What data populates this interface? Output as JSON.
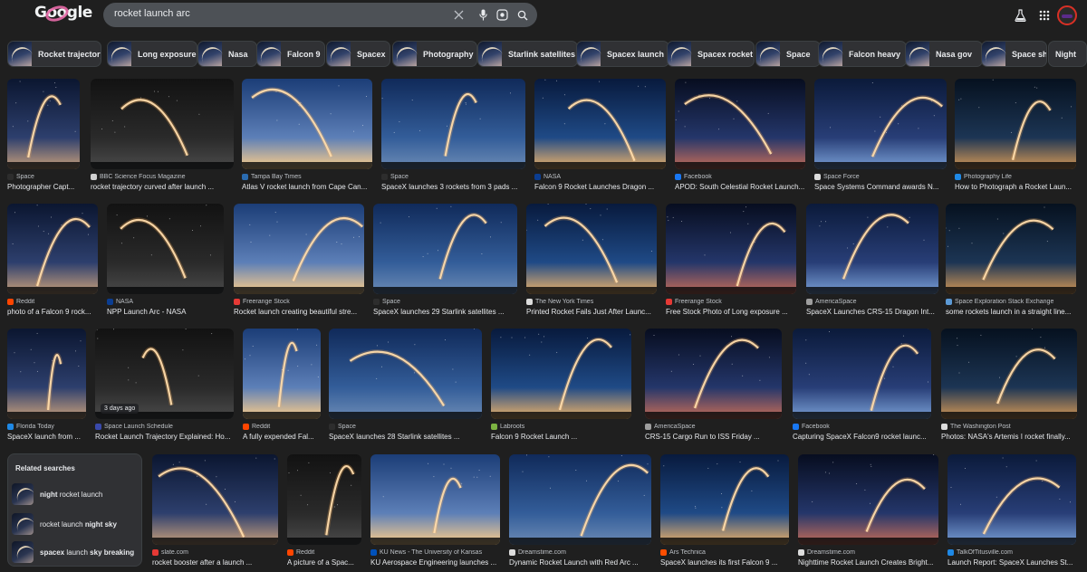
{
  "header": {
    "logo_text": "Google",
    "search_query": "rocket launch arc",
    "icons": [
      "clear-icon",
      "microphone-icon",
      "lens-icon",
      "search-icon",
      "labs-flask-icon",
      "apps-grid-icon"
    ]
  },
  "chips": [
    "Rocket trajectory",
    "Long exposure",
    "Nasa",
    "Falcon 9",
    "Spacex",
    "Photography",
    "Starlink satellites",
    "Spacex launch",
    "Spacex rocket",
    "Space",
    "Falcon heavy",
    "Nasa gov",
    "Space shuttle",
    "Night"
  ],
  "results": [
    [
      {
        "source": "Space",
        "caption": "Photographer Capt...",
        "fav": "#2d2d2d"
      },
      {
        "source": "BBC Science Focus Magazine",
        "caption": "rocket trajectory curved after launch ...",
        "fav": "#cfcfcf"
      },
      {
        "source": "Tampa Bay Times",
        "caption": "Atlas V rocket launch from Cape Can...",
        "fav": "#2a6bb0"
      },
      {
        "source": "Space",
        "caption": "SpaceX launches 3 rockets from 3 pads ...",
        "fav": "#2d2d2d"
      },
      {
        "source": "NASA",
        "caption": "Falcon 9 Rocket Launches Dragon ...",
        "fav": "#0b3d91"
      },
      {
        "source": "Facebook",
        "caption": "APOD: South Celestial Rocket Launch...",
        "fav": "#1877f2"
      },
      {
        "source": "Space Force",
        "caption": "Space Systems Command awards N...",
        "fav": "#dcdcdc"
      },
      {
        "source": "Photography Life",
        "caption": "How to Photograph a Rocket Laun...",
        "fav": "#1e88e5"
      }
    ],
    [
      {
        "source": "Reddit",
        "caption": "photo of a Falcon 9 rock...",
        "fav": "#ff4500"
      },
      {
        "source": "NASA",
        "caption": "NPP Launch Arc - NASA",
        "fav": "#0b3d91"
      },
      {
        "source": "Freerange Stock",
        "caption": "Rocket launch creating beautiful stre...",
        "fav": "#e53935"
      },
      {
        "source": "Space",
        "caption": "SpaceX launches 29 Starlink satellites ...",
        "fav": "#2d2d2d"
      },
      {
        "source": "The New York Times",
        "caption": "Printed Rocket Fails Just After Launc...",
        "fav": "#dcdcdc"
      },
      {
        "source": "Freerange Stock",
        "caption": "Free Stock Photo of Long exposure ...",
        "fav": "#e53935"
      },
      {
        "source": "AmericaSpace",
        "caption": "SpaceX Launches CRS-15 Dragon Int...",
        "fav": "#9e9e9e"
      },
      {
        "source": "Space Exploration Stack Exchange",
        "caption": "some rockets launch in a straight line...",
        "fav": "#5c9ad6"
      }
    ],
    [
      {
        "source": "Florida Today",
        "caption": "SpaceX launch from ...",
        "fav": "#1e88e5"
      },
      {
        "source": "Space Launch Schedule",
        "caption": "Rocket Launch Trajectory Explained: Ho...",
        "fav": "#3949ab",
        "badge_text": "3 days ago"
      },
      {
        "source": "Reddit",
        "caption": "A fully expended Fal...",
        "fav": "#ff4500"
      },
      {
        "source": "Space",
        "caption": "SpaceX launches 28 Starlink satellites ...",
        "fav": "#2d2d2d"
      },
      {
        "source": "Labroots",
        "caption": "Falcon 9 Rocket Launch ...",
        "fav": "#7cb342"
      },
      {
        "source": "AmericaSpace",
        "caption": "CRS-15 Cargo Run to ISS Friday ...",
        "fav": "#9e9e9e"
      },
      {
        "source": "Facebook",
        "caption": "Capturing SpaceX Falcon9 rocket launc...",
        "fav": "#1877f2"
      },
      {
        "source": "The Washington Post",
        "caption": "Photos: NASA's Artemis I rocket finally...",
        "fav": "#dcdcdc"
      }
    ],
    [
      {
        "source": "slate.com",
        "caption": "rocket booster after a launch ...",
        "fav": "#e53935"
      },
      {
        "source": "Reddit",
        "caption": "A picture of a Spac...",
        "fav": "#ff4500"
      },
      {
        "source": "KU News - The University of Kansas",
        "caption": "KU Aerospace Engineering launches ...",
        "fav": "#0051ba"
      },
      {
        "source": "Dreamstime.com",
        "caption": "Dynamic Rocket Launch with Red Arc ...",
        "fav": "#dcdcdc"
      },
      {
        "source": "Ars Technica",
        "caption": "SpaceX launches its first Falcon 9 ...",
        "fav": "#ff4e00"
      },
      {
        "source": "Dreamstime.com",
        "caption": "Nighttime Rocket Launch Creates Bright...",
        "fav": "#dcdcdc"
      },
      {
        "source": "TalkOfTitusville.com",
        "caption": "Launch Report: SpaceX Launches St...",
        "fav": "#1e88e5"
      }
    ]
  ],
  "related": {
    "title": "Related searches",
    "items": [
      {
        "bold": "night",
        "rest": " rocket launch",
        "mode": "prefix"
      },
      {
        "bold": "night sky",
        "rest": "rocket launch ",
        "mode": "suffix"
      },
      {
        "bold": "spacex",
        "bold2": "sky breaking",
        "mid": " launch ",
        "mode": "both"
      }
    ]
  }
}
